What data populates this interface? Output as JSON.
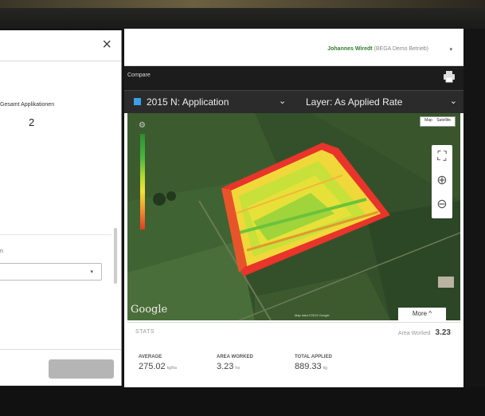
{
  "modal": {
    "close": "×",
    "gesamt_label": "Gesamt Applikationen",
    "gesamt_value": "2",
    "small_label": "n",
    "select_caret": "▾"
  },
  "header": {
    "user_name": "Johannes Wiredt",
    "user_org": "(BEGA Demo Betrieb)",
    "user_caret": "▾",
    "compare_label": "Compare"
  },
  "app_bar": {
    "application": "2015 N: Application",
    "app_caret": "⌄",
    "layer": "Layer: As Applied Rate",
    "layer_caret": "⌄"
  },
  "map": {
    "maptype_map": "Map",
    "maptype_satellite": "Satellite",
    "gear": "⚙",
    "zoom_fit": "⛶",
    "zoom_in": "⊕",
    "zoom_out": "⊖",
    "google": "Google",
    "more": "More ^",
    "credits": "Map data ©2015 Google"
  },
  "stats": {
    "title": "STATS",
    "area_worked_label": "Area Worked",
    "area_worked_value": "3.23",
    "average_label": "AVERAGE",
    "average_value": "275.02",
    "average_unit": "kg/ha",
    "area_label": "AREA WORKED",
    "area_value": "3.23",
    "area_unit": "ha",
    "total_label": "TOTAL APPLIED",
    "total_value": "889.33",
    "total_unit": "kg"
  },
  "colors": {
    "accent_blue": "#3aa0e8",
    "user_green": "#2f7d2f"
  }
}
